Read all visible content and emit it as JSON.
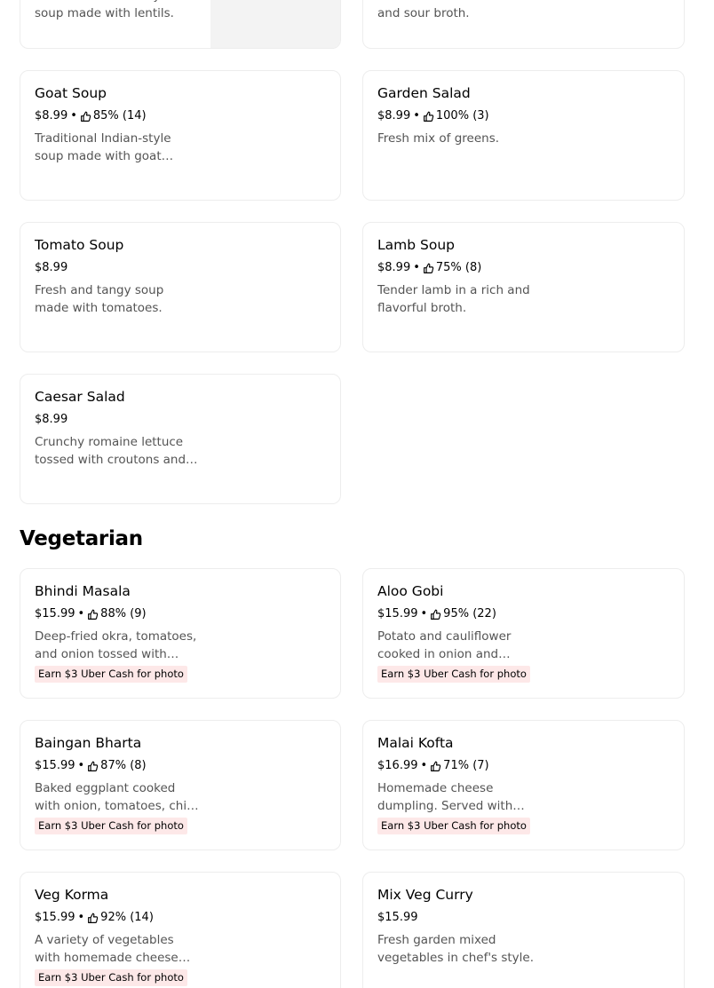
{
  "top_partial": {
    "left_desc": "Traditional Indian-style soup made with lentils.",
    "right_desc": "Tender chicken in a sweet and sour broth."
  },
  "sections": {
    "vegetarian_title": "Vegetarian"
  },
  "items": {
    "goat_soup": {
      "name": "Goat Soup",
      "price": "$8.99",
      "rating": "85% (14)",
      "desc": "Traditional Indian-style soup made with goat meat."
    },
    "garden_salad": {
      "name": "Garden Salad",
      "price": "$8.99",
      "rating": "100% (3)",
      "desc": "Fresh mix of greens."
    },
    "tomato_soup": {
      "name": "Tomato Soup",
      "price": "$8.99",
      "desc": "Fresh and tangy soup made with tomatoes."
    },
    "lamb_soup": {
      "name": "Lamb Soup",
      "price": "$8.99",
      "rating": "75% (8)",
      "desc": "Tender lamb in a rich and flavorful broth."
    },
    "caesar_salad": {
      "name": "Caesar Salad",
      "price": "$8.99",
      "desc": "Crunchy romaine lettuce tossed with croutons and dressing."
    },
    "bhindi_masala": {
      "name": "Bhindi Masala",
      "price": "$15.99",
      "rating": "88% (9)",
      "desc": "Deep-fried okra, tomatoes, and onion tossed with onion and spices.",
      "promo": "Earn $3 Uber Cash for photo"
    },
    "aloo_gobi": {
      "name": "Aloo Gobi",
      "price": "$15.99",
      "rating": "95% (22)",
      "desc": "Potato and cauliflower cooked in onion and tomato sauce.",
      "promo": "Earn $3 Uber Cash for photo"
    },
    "baingan_bharta": {
      "name": "Baingan Bharta",
      "price": "$15.99",
      "rating": "87% (8)",
      "desc": "Baked eggplant cooked with onion, tomatoes, chili, and spices.",
      "promo": "Earn $3 Uber Cash for photo"
    },
    "malai_kofta": {
      "name": "Malai Kofta",
      "price": "$16.99",
      "rating": "71% (7)",
      "desc": "Homemade cheese dumpling. Served with creamy sauce.",
      "promo": "Earn $3 Uber Cash for photo"
    },
    "veg_korma": {
      "name": "Veg Korma",
      "price": "$15.99",
      "rating": "92% (14)",
      "desc": "A variety of vegetables with homemade cheese cooked in creamy sauce.",
      "promo": "Earn $3 Uber Cash for photo"
    },
    "mix_veg_curry": {
      "name": "Mix Veg Curry",
      "price": "$15.99",
      "desc": "Fresh garden mixed vegetables in chef's style."
    }
  },
  "separator": "•",
  "icons": {
    "rating": "thumbs-up-icon"
  },
  "colors": {
    "promo_bg": "#fde8e8",
    "border": "#ededed",
    "muted_text": "#545454"
  }
}
